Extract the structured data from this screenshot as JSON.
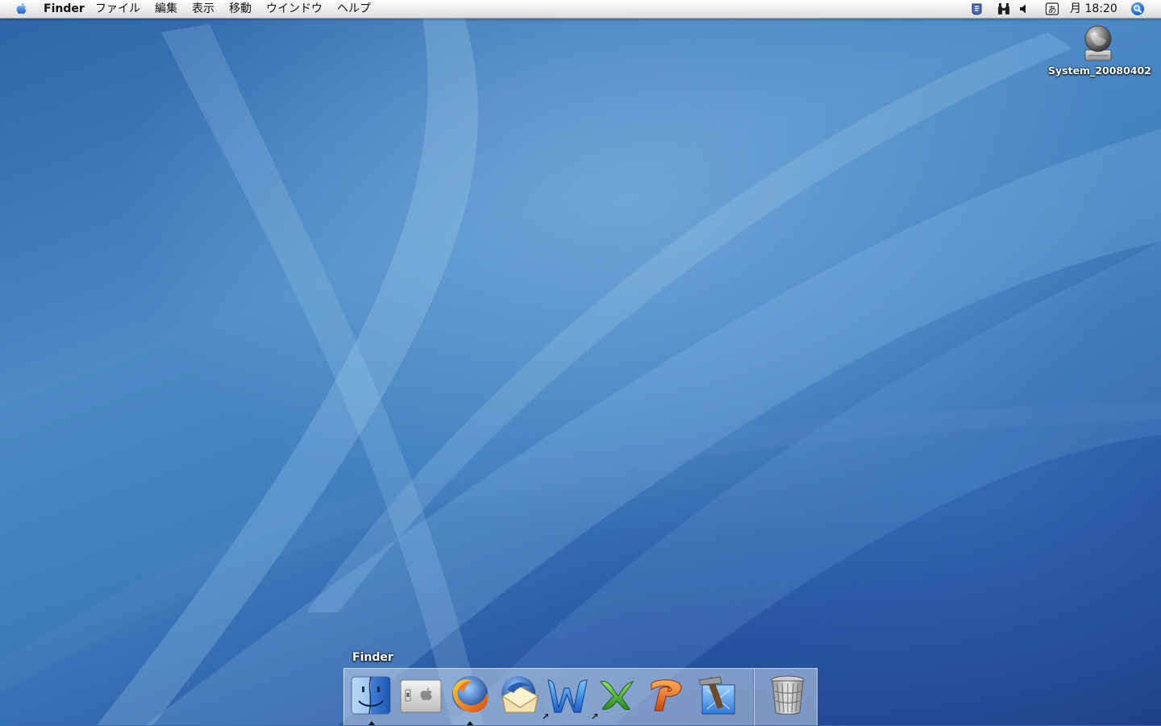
{
  "menubar": {
    "app_name": "Finder",
    "menus": [
      "ファイル",
      "編集",
      "表示",
      "移動",
      "ウインドウ",
      "ヘルプ"
    ],
    "clock": "月 18:20",
    "status_icons": [
      "script-menu-icon",
      "search-binoculars-icon",
      "volume-icon",
      "input-method-icon",
      "spotlight-icon"
    ]
  },
  "desktop": {
    "disk_label": "System_20080402"
  },
  "dock": {
    "tooltip": "Finder",
    "items": [
      {
        "name": "finder-icon",
        "running": true
      },
      {
        "name": "system-preferences-icon",
        "running": false
      },
      {
        "name": "firefox-icon",
        "running": true
      },
      {
        "name": "thunderbird-icon",
        "running": false
      },
      {
        "name": "word-icon",
        "running": false,
        "alias": true
      },
      {
        "name": "excel-icon",
        "running": false,
        "alias": true
      },
      {
        "name": "powerpoint-icon",
        "running": false
      },
      {
        "name": "xcode-icon",
        "running": false
      },
      {
        "name": "trash-icon",
        "running": false
      }
    ]
  },
  "colors": {
    "wallpaper_blue": "#2f6db3",
    "menubar_bg": "#ececec"
  }
}
